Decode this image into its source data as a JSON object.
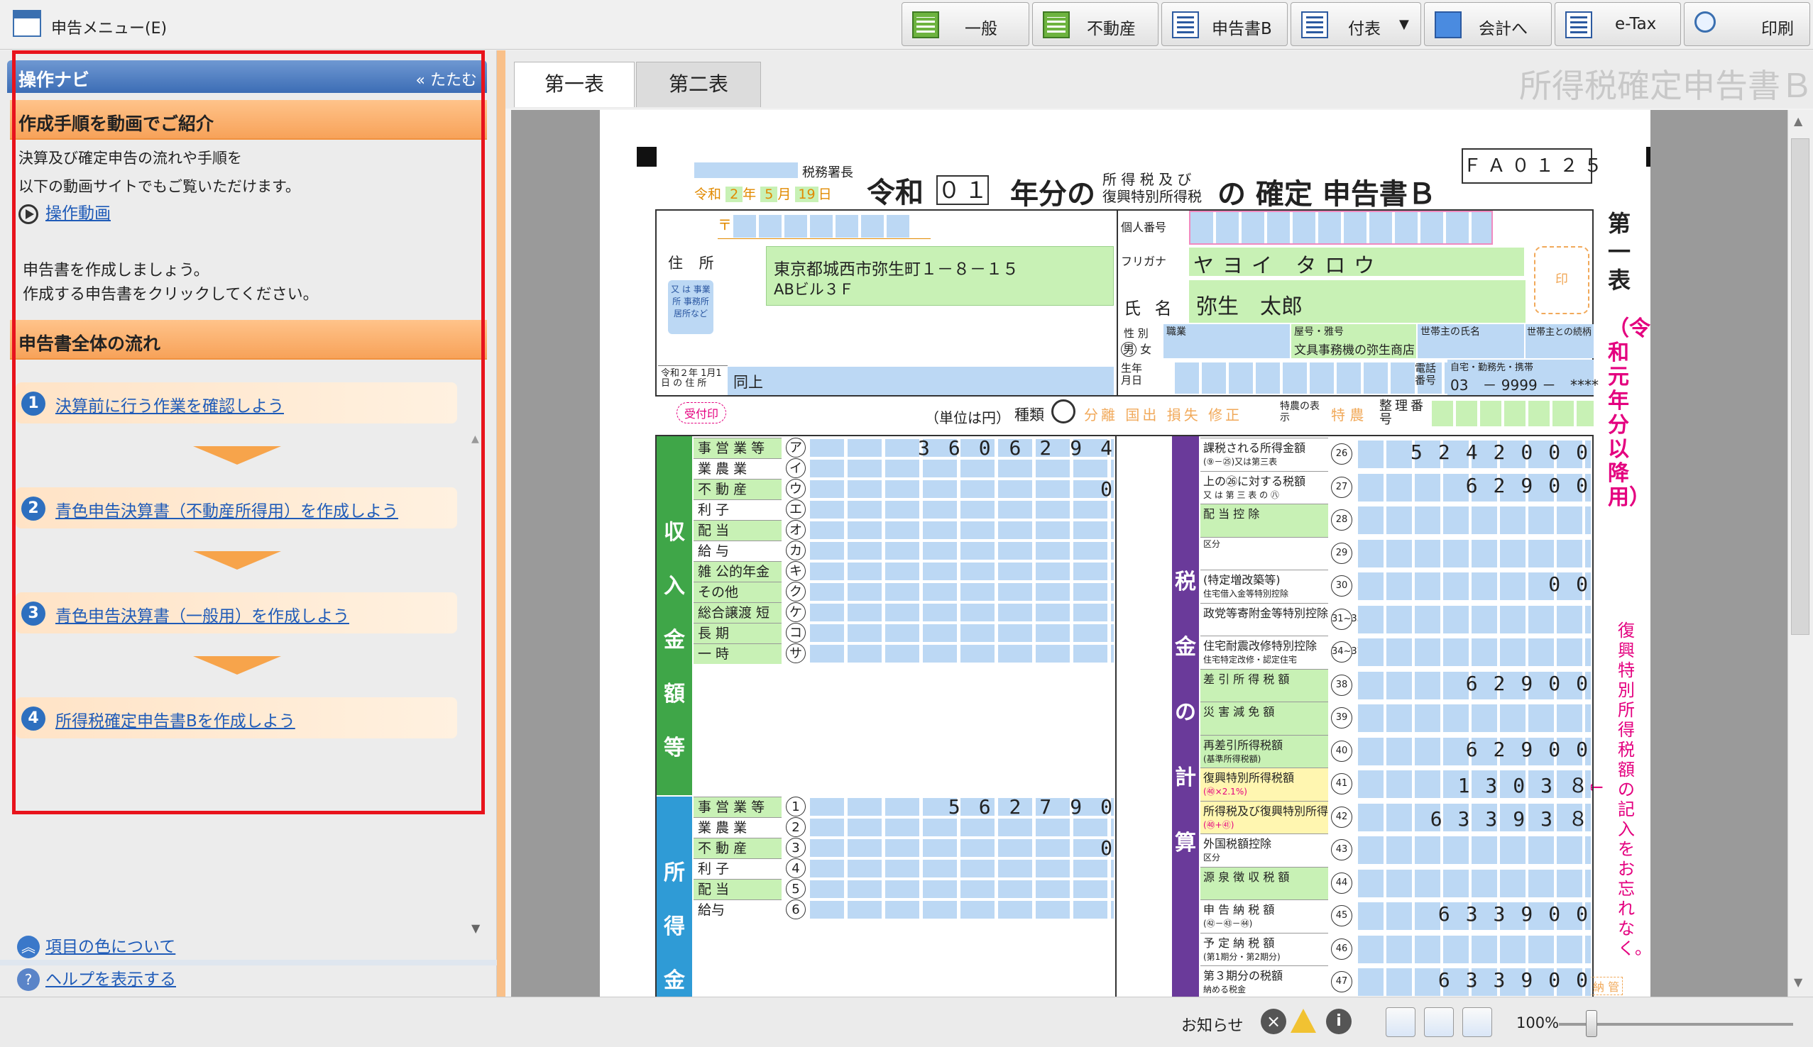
{
  "app": {
    "menu_title": "申告メニュー(E)"
  },
  "toolbar": [
    {
      "label": "一般",
      "icon": "ledger-green-icon"
    },
    {
      "label": "不動産",
      "icon": "ledger-green-icon"
    },
    {
      "label": "申告書B",
      "icon": "form-icon"
    },
    {
      "label": "付表",
      "icon": "form-icon"
    },
    {
      "label": "会計へ",
      "icon": "accounting-icon"
    },
    {
      "label": "e-Tax",
      "icon": "form-icon"
    },
    {
      "label": "印刷",
      "icon": "print-preview-icon"
    }
  ],
  "nav": {
    "title": "操作ナビ",
    "collapse": "たたむ",
    "collapse_icon": "«",
    "video_heading": "作成手順を動画でご紹介",
    "video_text_1": "決算及び確定申告の流れや手順を",
    "video_text_2": "以下の動画サイトでもご覧いただけます。",
    "video_link": "操作動画",
    "instruction_1": "申告書を作成しましょう。",
    "instruction_2": "作成する申告書をクリックしてください。",
    "flow_heading": "申告書全体の流れ",
    "steps": [
      {
        "num": "1",
        "label": "決算前に行う作業を確認しよう"
      },
      {
        "num": "2",
        "label": "青色申告決算書（不動産所得用）を作成しよう"
      },
      {
        "num": "3",
        "label": "青色申告決算書（一般用）を作成しよう"
      },
      {
        "num": "4",
        "label": "所得税確定申告書Bを作成しよう"
      }
    ],
    "color_help": "項目の色について",
    "show_help": "ヘルプを表示する"
  },
  "tabs": [
    "第一表",
    "第二表"
  ],
  "form_title": "所得税確定申告書Ｂ",
  "form": {
    "tax_office": "税務署長",
    "date": {
      "era": "令和",
      "y": "2",
      "y_u": "年",
      "m": "5",
      "m_u": "月",
      "d": "19",
      "d_u": "日"
    },
    "heading_reiwa": "令和",
    "heading_year": "０１",
    "heading_nenbun": "年分の",
    "heading_small_1": "所 得 税 及 び",
    "heading_small_2": "復興特別所得税",
    "heading_main": "の 確定 申告書Ｂ",
    "code": "ＦＡ０１２５",
    "side_1": "第一表",
    "side_2": "（令和元年分以降用）",
    "side_note": "復興特別所得税額の記入をお忘れなく。",
    "address_label": "住 所",
    "address": "東京都城西市弥生町１－８－１５",
    "address2": "ABビル３Ｆ",
    "addr_alt": "又 は 事業所 事務所 居所など",
    "prev_addr_label": "令和２年 1月1日 の 住 所",
    "prev_addr": "同上",
    "my_number_label": "個人番号",
    "furigana_label": "フリガナ",
    "furigana": "ヤヨイ タロウ",
    "name_label": "氏 名",
    "name": "弥生　太郎",
    "seal": "印",
    "gender_label": "性 別",
    "gender_m": "男",
    "gender_f": "女",
    "job_label": "職業",
    "shop_label": "屋号・雅号",
    "shop": "文具事務機の弥生商店",
    "head_label": "世帯主の氏名",
    "rel_label": "世帯主との続柄",
    "birth_label": "生年月日",
    "tel_label": "電話番号",
    "tel_type": "自宅・勤務先・携帯",
    "tel": "03　－ 9999 －　****",
    "unit": "（単位は円）",
    "kind_label": "種類",
    "kinds": [
      "分",
      "離",
      "国",
      "出",
      "損",
      "失",
      "修",
      "正"
    ],
    "special_label": "特農の表示",
    "special": "特 農",
    "seiri": "整理番号",
    "receipt": "受付印",
    "income_section": "収入金額等",
    "income_rows": [
      {
        "label": "事 営 業 等",
        "no": "ア",
        "value": "3606294"
      },
      {
        "label": "業 農 業",
        "no": "イ",
        "value": ""
      },
      {
        "label": "不 動 産",
        "no": "ウ",
        "value": "0"
      },
      {
        "label": "利 子",
        "no": "エ",
        "value": ""
      },
      {
        "label": "配 当",
        "no": "オ",
        "value": ""
      },
      {
        "label": "給 与",
        "no": "カ",
        "value": ""
      },
      {
        "label": "雑 公的年金等",
        "no": "キ",
        "value": ""
      },
      {
        "label": "その他",
        "no": "ク",
        "value": ""
      },
      {
        "label": "総合譲渡 短 期",
        "no": "ケ",
        "value": ""
      },
      {
        "label": "長 期",
        "no": "コ",
        "value": ""
      },
      {
        "label": "一 時",
        "no": "サ",
        "value": ""
      }
    ],
    "shotoku_section": "所得金",
    "shotoku_rows": [
      {
        "label": "事 営 業 等",
        "no": "1",
        "value": "562790"
      },
      {
        "label": "業 農 業",
        "no": "2",
        "value": ""
      },
      {
        "label": "不 動 産",
        "no": "3",
        "value": "0"
      },
      {
        "label": "利 子",
        "no": "4",
        "value": ""
      },
      {
        "label": "配 当",
        "no": "5",
        "value": ""
      },
      {
        "label": "給与",
        "no": "6",
        "value": ""
      }
    ],
    "tax_section": "税金の計算",
    "tax_rows": [
      {
        "label": "課税される所得金額",
        "sub": "(⑨－㉕)又は第三表",
        "no": "26",
        "value": "5242000"
      },
      {
        "label": "上の㉖に対する税額",
        "sub": "又 は 第 三 表 の ㊇",
        "no": "27",
        "value": "62900"
      },
      {
        "label": "配 当 控 除",
        "sub": "",
        "no": "28",
        "value": ""
      },
      {
        "label": "",
        "sub": "区分",
        "no": "29",
        "value": ""
      },
      {
        "label": "(特定増改築等)",
        "sub": "住宅借入金等特別控除",
        "no": "30",
        "value": "00"
      },
      {
        "label": "政党等寄附金等特別控除",
        "sub": "",
        "no": "31~33",
        "value": ""
      },
      {
        "label": "住宅耐震改修特別控除",
        "sub": "住宅特定改修・認定住宅",
        "no": "34~37",
        "value": ""
      },
      {
        "label": "差 引 所 得 税 額",
        "sub": "",
        "no": "38",
        "value": "62900"
      },
      {
        "label": "災 害 減 免 額",
        "sub": "",
        "no": "39",
        "value": ""
      },
      {
        "label": "再差引所得税額",
        "sub": "(基準所得税額)",
        "no": "40",
        "value": "62900"
      },
      {
        "label": "復興特別所得税額",
        "sub": "(㊵×2.1%)",
        "no": "41",
        "value": "1303８"
      },
      {
        "label": "所得税及び復興特別所得税の額",
        "sub": "(㊵+㊶)",
        "no": "42",
        "value": "63393８"
      },
      {
        "label": "外国税額控除",
        "sub": "区分",
        "no": "43",
        "value": ""
      },
      {
        "label": "源 泉 徴 収 税 額",
        "sub": "",
        "no": "44",
        "value": ""
      },
      {
        "label": "申 告 納 税 額",
        "sub": "(㊷－㊸－㊹)",
        "no": "45",
        "value": "633900"
      },
      {
        "label": "予 定 納 税 額",
        "sub": "(第1期分・第2期分)",
        "no": "46",
        "value": ""
      },
      {
        "label": "第３期分の税額",
        "sub": "納める税金",
        "no": "47",
        "value": "633900"
      }
    ],
    "kanri": "納 管"
  },
  "status": {
    "notice": "お知らせ",
    "zoom": "100%"
  },
  "colors": {
    "accent_blue": "#3c6db5",
    "orange": "#f7a259",
    "form_green": "#c8f1b5",
    "form_blue": "#bcd8f4",
    "form_pink": "#e4007f",
    "highlight_red": "#e8131c",
    "income_green": "#3fa648",
    "shotoku_blue": "#2f9bd6",
    "tax_purple": "#6a3a9a"
  }
}
